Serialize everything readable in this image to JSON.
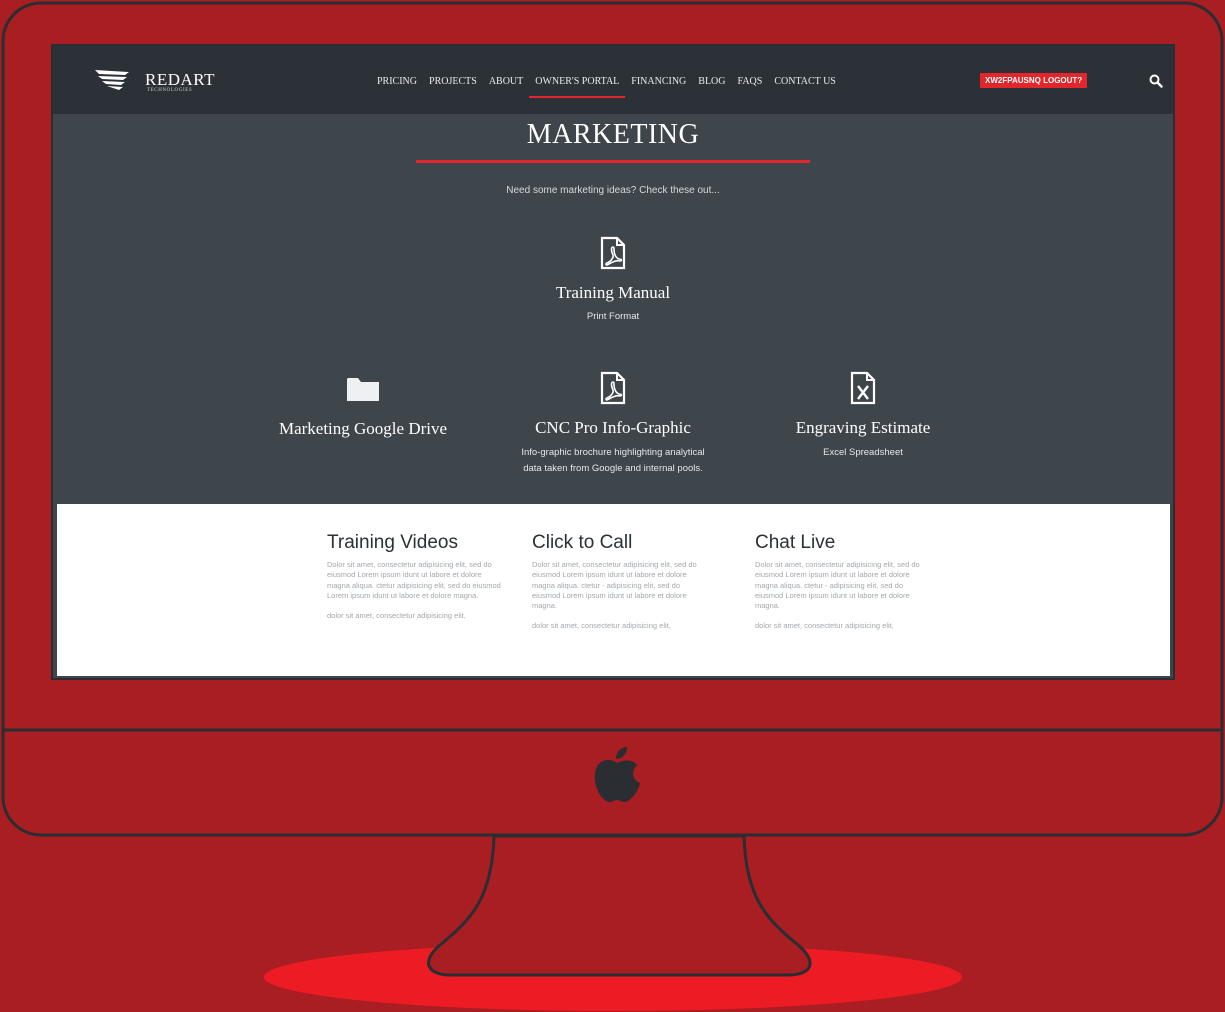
{
  "brand": {
    "name": "REDART",
    "tagline": "TECHNOLOGIES"
  },
  "nav": {
    "items": [
      {
        "label": "PRICING"
      },
      {
        "label": "PROJECTS"
      },
      {
        "label": "ABOUT"
      },
      {
        "label": "OWNER'S PORTAL",
        "active": true
      },
      {
        "label": "FINANCING"
      },
      {
        "label": "BLOG"
      },
      {
        "label": "FAQS"
      },
      {
        "label": "CONTACT US"
      }
    ],
    "logout_label": "XW2FPAUSNQ LOGOUT?",
    "search_icon": "search-icon"
  },
  "page": {
    "title": "MARKETING",
    "intro": "Need some marketing ideas? Check these out..."
  },
  "resources": {
    "training_manual": {
      "title": "Training Manual",
      "subtitle": "Print Format",
      "icon": "pdf-file-icon"
    },
    "google_drive": {
      "title": "Marketing Google Drive",
      "icon": "folder-icon"
    },
    "cnc_infographic": {
      "title": "CNC Pro Info-Graphic",
      "subtitle_line1": "Info-graphic brochure highlighting analytical",
      "subtitle_line2": "data taken from Google and internal pools.",
      "icon": "pdf-file-icon"
    },
    "engraving_estimate": {
      "title": "Engraving Estimate",
      "subtitle": "Excel Spreadsheet",
      "icon": "excel-file-icon"
    }
  },
  "features": [
    {
      "title": "Training Videos",
      "text": "Dolor sit amet, consectetur adipisicing elit, sed do eiusmod  Lorem ipsum idunt ut labore et dolore magna aliqua. ctetur adipisicing elit, sed do eiusmod  Lorem ipsum idunt ut labore et dolore magna.",
      "text2": "dolor sit amet, consectetur adipisicing elit,"
    },
    {
      "title": "Click to Call",
      "text": "Dolor sit amet, consectetur adipisicing elit, sed do eiusmod  Lorem ipsum idunt ut labore et dolore magna aliqua. ctetur    - adipisicing elit, sed do eiusmod  Lorem ipsum idunt ut labore et dolore magna.",
      "text2": "dolor sit amet, consectetur adipisicing elit,"
    },
    {
      "title": "Chat Live",
      "text": "Dolor sit amet, consectetur adipisicing elit, sed do eiusmod  Lorem ipsum idunt ut labore et dolore magna aliqua. ctetur    - adipisicing elit, sed do eiusmod  Lorem ipsum idunt ut labore et dolore magna.",
      "text2": "dolor sit amet, consectetur adipisicing elit,"
    }
  ],
  "colors": {
    "background": "#a81e22",
    "accent": "#e3262b",
    "nav_bg": "#2b3136",
    "content_bg": "#3e454b"
  },
  "device_icon": "apple-logo-icon"
}
